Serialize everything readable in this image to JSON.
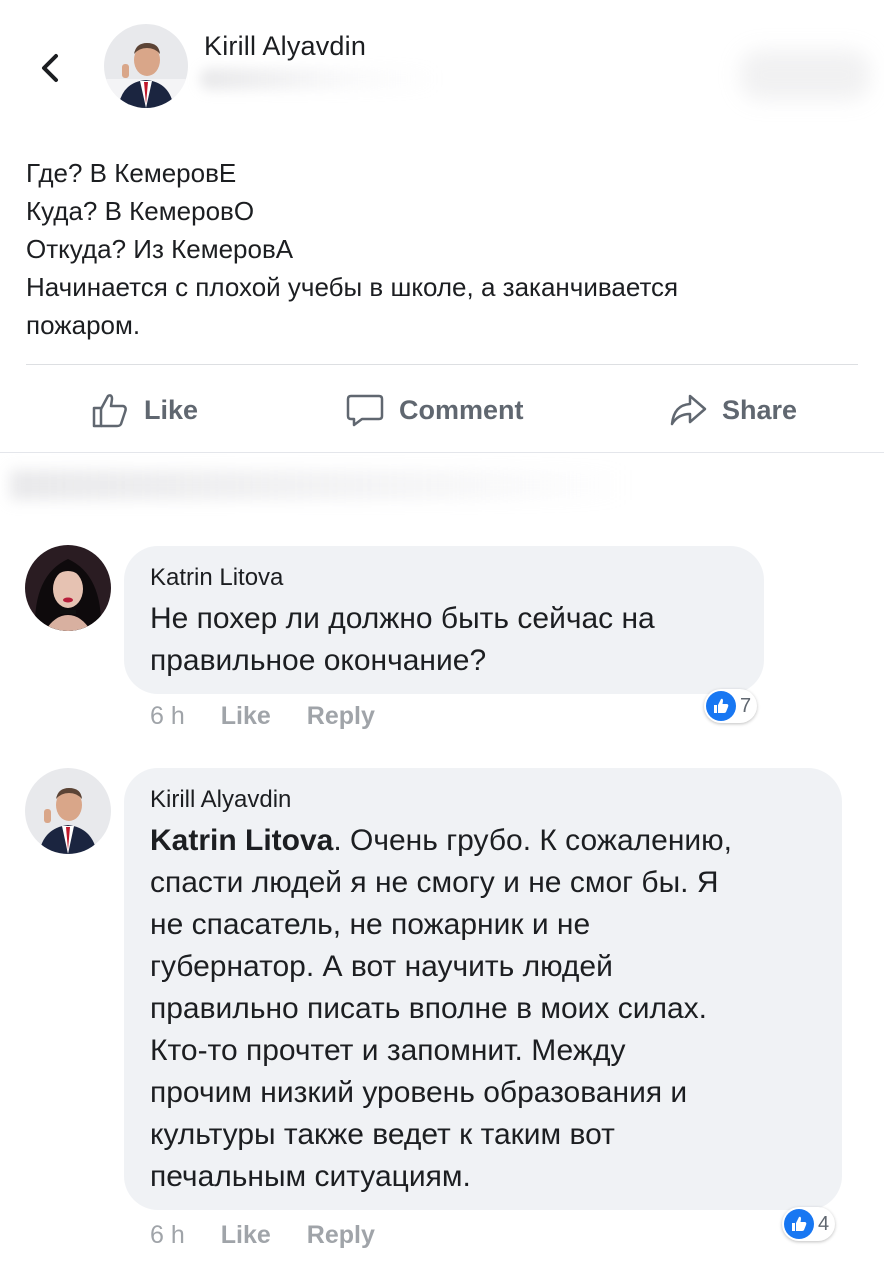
{
  "post": {
    "author_name": "Kirill Alyavdin",
    "lines": [
      "Где? В КемеровЕ",
      "Куда? В КемеровО",
      "Откуда? Из КемеровА",
      "Начинается с плохой учебы в школе, а заканчивается",
      "пожаром."
    ]
  },
  "actions": {
    "like_label": "Like",
    "comment_label": "Comment",
    "share_label": "Share"
  },
  "comments": [
    {
      "author": "Katrin Litova",
      "lines": [
        "Не похер ли должно быть сейчас на",
        "правильное окончание?"
      ],
      "time": "6 h",
      "like_label": "Like",
      "reply_label": "Reply",
      "reaction_count": "7"
    },
    {
      "author": "Kirill Alyavdin",
      "mention": "Katrin Litova",
      "first_line_rest": ". Очень грубо. К сожалению,",
      "lines": [
        "спасти людей я не смогу и не смог бы. Я",
        "не спасатель, не пожарник и не",
        "губернатор. А вот научить людей",
        "правильно писать вполне в моих силах.",
        "Кто-то прочтет и запомнит. Между",
        "прочим низкий уровень образования и",
        "культуры также ведет к таким вот",
        "печальным ситуациям."
      ],
      "time": "6 h",
      "like_label": "Like",
      "reply_label": "Reply",
      "reaction_count": "4"
    }
  ],
  "icons": {
    "back": "chevron-left-icon",
    "like": "thumbs-up-icon",
    "comment": "speech-bubble-icon",
    "share": "share-arrow-icon",
    "reaction": "like-reaction-icon"
  },
  "colors": {
    "accent": "#1877f2",
    "bubble": "#f0f2f5",
    "muted": "#606770",
    "meta": "#a0a4a9"
  }
}
